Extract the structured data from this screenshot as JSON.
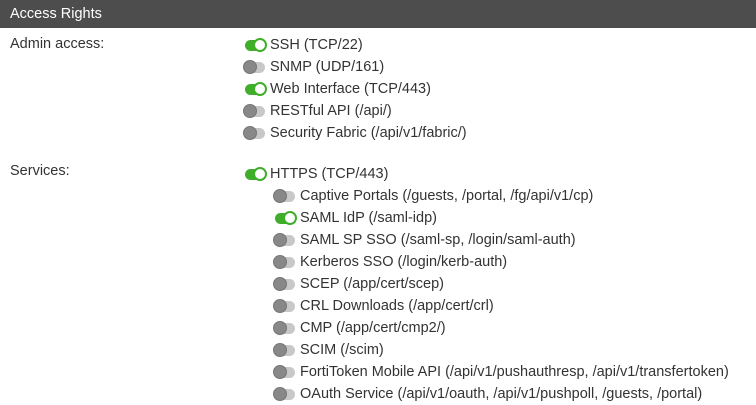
{
  "header": {
    "title": "Access Rights"
  },
  "admin": {
    "label": "Admin access:",
    "items": [
      {
        "label": "SSH (TCP/22)",
        "on": true
      },
      {
        "label": "SNMP (UDP/161)",
        "on": false
      },
      {
        "label": "Web Interface (TCP/443)",
        "on": true
      },
      {
        "label": "RESTful API (/api/)",
        "on": false
      },
      {
        "label": "Security Fabric (/api/v1/fabric/)",
        "on": false
      }
    ]
  },
  "services": {
    "label": "Services:",
    "parent": {
      "label": "HTTPS (TCP/443)",
      "on": true
    },
    "items": [
      {
        "label": "Captive Portals (/guests, /portal, /fg/api/v1/cp)",
        "on": false
      },
      {
        "label": "SAML IdP (/saml-idp)",
        "on": true
      },
      {
        "label": "SAML SP SSO (/saml-sp, /login/saml-auth)",
        "on": false
      },
      {
        "label": "Kerberos SSO (/login/kerb-auth)",
        "on": false
      },
      {
        "label": "SCEP (/app/cert/scep)",
        "on": false
      },
      {
        "label": "CRL Downloads (/app/cert/crl)",
        "on": false
      },
      {
        "label": "CMP (/app/cert/cmp2/)",
        "on": false
      },
      {
        "label": "SCIM (/scim)",
        "on": false
      },
      {
        "label": "FortiToken Mobile API (/api/v1/pushauthresp, /api/v1/transfertoken)",
        "on": false
      },
      {
        "label": "OAuth Service (/api/v1/oauth, /api/v1/pushpoll, /guests, /portal)",
        "on": false
      }
    ]
  }
}
